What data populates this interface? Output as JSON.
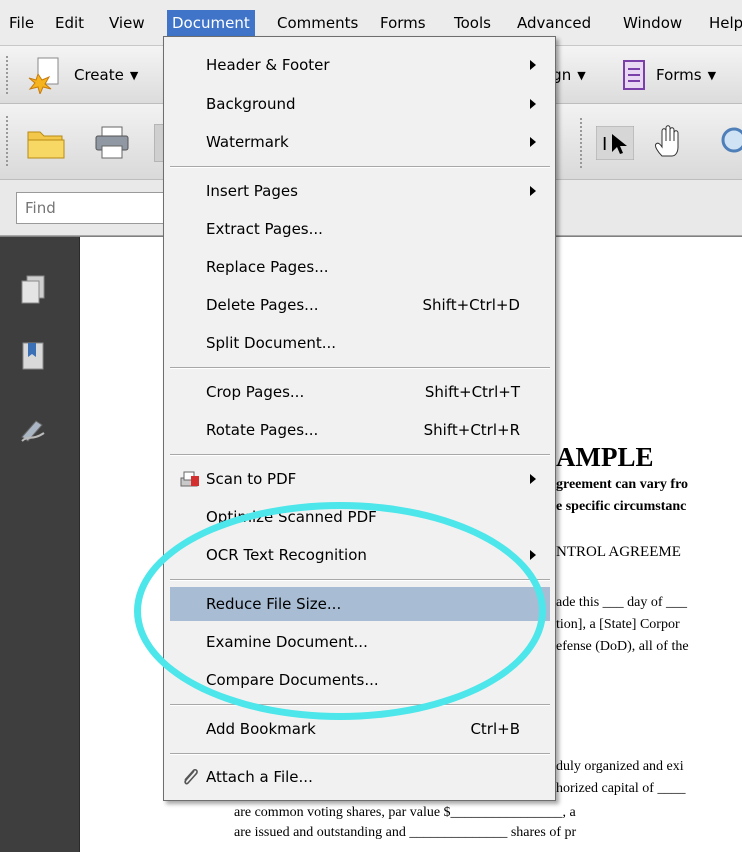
{
  "menubar": {
    "items": [
      "File",
      "Edit",
      "View",
      "Document",
      "Comments",
      "Forms",
      "Tools",
      "Advanced",
      "Window",
      "Help"
    ]
  },
  "toolbar": {
    "create_label": "Create",
    "sign_label": "ign",
    "forms_label": "Forms"
  },
  "find": {
    "placeholder": "Find"
  },
  "document_menu": {
    "header_footer": "Header & Footer",
    "background": "Background",
    "watermark": "Watermark",
    "insert_pages": "Insert Pages",
    "extract_pages": "Extract Pages...",
    "replace_pages": "Replace Pages...",
    "delete_pages": "Delete Pages...",
    "delete_pages_shortcut": "Shift+Ctrl+D",
    "split_document": "Split Document...",
    "crop_pages": "Crop Pages...",
    "crop_pages_shortcut": "Shift+Ctrl+T",
    "rotate_pages": "Rotate Pages...",
    "rotate_pages_shortcut": "Shift+Ctrl+R",
    "scan_to_pdf": "Scan to PDF",
    "optimize_scanned_pdf": "Optimize Scanned PDF",
    "ocr_text_recognition": "OCR Text Recognition",
    "reduce_file_size": "Reduce File Size...",
    "examine_document": "Examine Document...",
    "compare_documents": "Compare Documents...",
    "add_bookmark": "Add Bookmark",
    "add_bookmark_shortcut": "Ctrl+B",
    "attach_a_file": "Attach a File..."
  },
  "document": {
    "heading": "AMPLE",
    "lines": [
      "greement can vary fro",
      "e specific circumstanc",
      "NTROL AGREEME",
      "ade this ___ day of ___",
      "tion], a [State] Corpor",
      "efense (DoD), all of the",
      "duly organized and exi",
      "horized capital of ____",
      "are common voting shares, par value $________________, a",
      "are issued and outstanding and ______________ shares of pr"
    ]
  },
  "colors": {
    "menu_active": "#3f74c8",
    "menu_highlight": "#a8bdd4",
    "annotation": "#4de6ea"
  }
}
